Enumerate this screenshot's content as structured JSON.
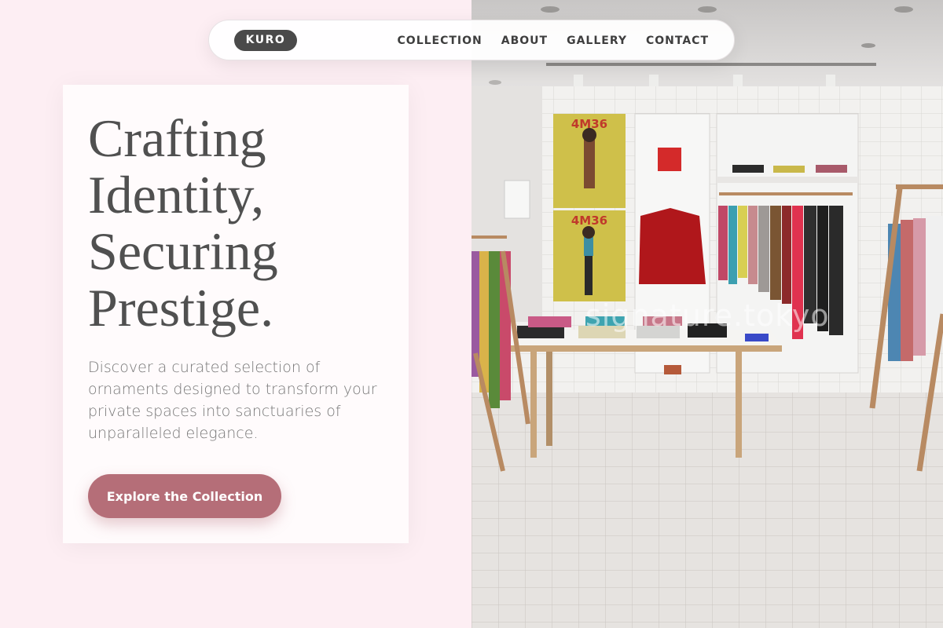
{
  "nav": {
    "logo": "KURO",
    "links": [
      "COLLECTION",
      "ABOUT",
      "GALLERY",
      "CONTACT"
    ]
  },
  "hero": {
    "title_lines": [
      "Crafting",
      "Identity,",
      "Securing",
      "Prestige."
    ],
    "description": "Discover a curated selection of ornaments designed to transform your private spaces into sanctuaries of unparalleled elegance.",
    "cta_label": "Explore the Collection"
  },
  "image": {
    "poster_text_top": "4M36",
    "poster_text_bottom": "4M36",
    "watermark": "signature.tokyo"
  },
  "colors": {
    "background": "#fdeef3",
    "card": "#fffbfc",
    "accent": "#b56e78",
    "logo_bg": "#4a4a4a",
    "title_text": "#505050"
  }
}
